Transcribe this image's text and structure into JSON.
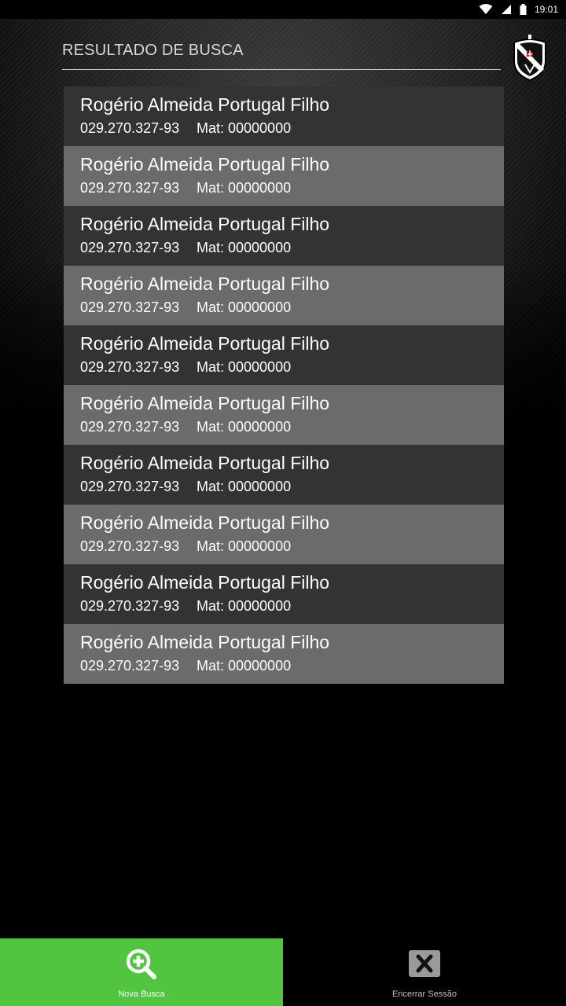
{
  "status_bar": {
    "time": "19:01"
  },
  "header": {
    "title": "RESULTADO DE BUSCA",
    "logo": "club-crest-icon"
  },
  "results": [
    {
      "name": "Rogério Almeida Portugal Filho",
      "cpf": "029.270.327-93",
      "mat": "Mat: 00000000"
    },
    {
      "name": "Rogério Almeida Portugal Filho",
      "cpf": "029.270.327-93",
      "mat": "Mat: 00000000"
    },
    {
      "name": "Rogério Almeida Portugal Filho",
      "cpf": "029.270.327-93",
      "mat": "Mat: 00000000"
    },
    {
      "name": "Rogério Almeida Portugal Filho",
      "cpf": "029.270.327-93",
      "mat": "Mat: 00000000"
    },
    {
      "name": "Rogério Almeida Portugal Filho",
      "cpf": "029.270.327-93",
      "mat": "Mat: 00000000"
    },
    {
      "name": "Rogério Almeida Portugal Filho",
      "cpf": "029.270.327-93",
      "mat": "Mat: 00000000"
    },
    {
      "name": "Rogério Almeida Portugal Filho",
      "cpf": "029.270.327-93",
      "mat": "Mat: 00000000"
    },
    {
      "name": "Rogério Almeida Portugal Filho",
      "cpf": "029.270.327-93",
      "mat": "Mat: 00000000"
    },
    {
      "name": "Rogério Almeida Portugal Filho",
      "cpf": "029.270.327-93",
      "mat": "Mat: 00000000"
    },
    {
      "name": "Rogério Almeida Portugal Filho",
      "cpf": "029.270.327-93",
      "mat": "Mat: 00000000"
    }
  ],
  "bottom_nav": {
    "new_search": {
      "label": "Nova Busca",
      "icon": "zoom-in-icon"
    },
    "end_session": {
      "label": "Encerrar Sessão",
      "icon": "close-icon"
    }
  },
  "colors": {
    "accent": "#52c540",
    "row_dark": "#333333",
    "row_light": "#6b6b6b"
  }
}
